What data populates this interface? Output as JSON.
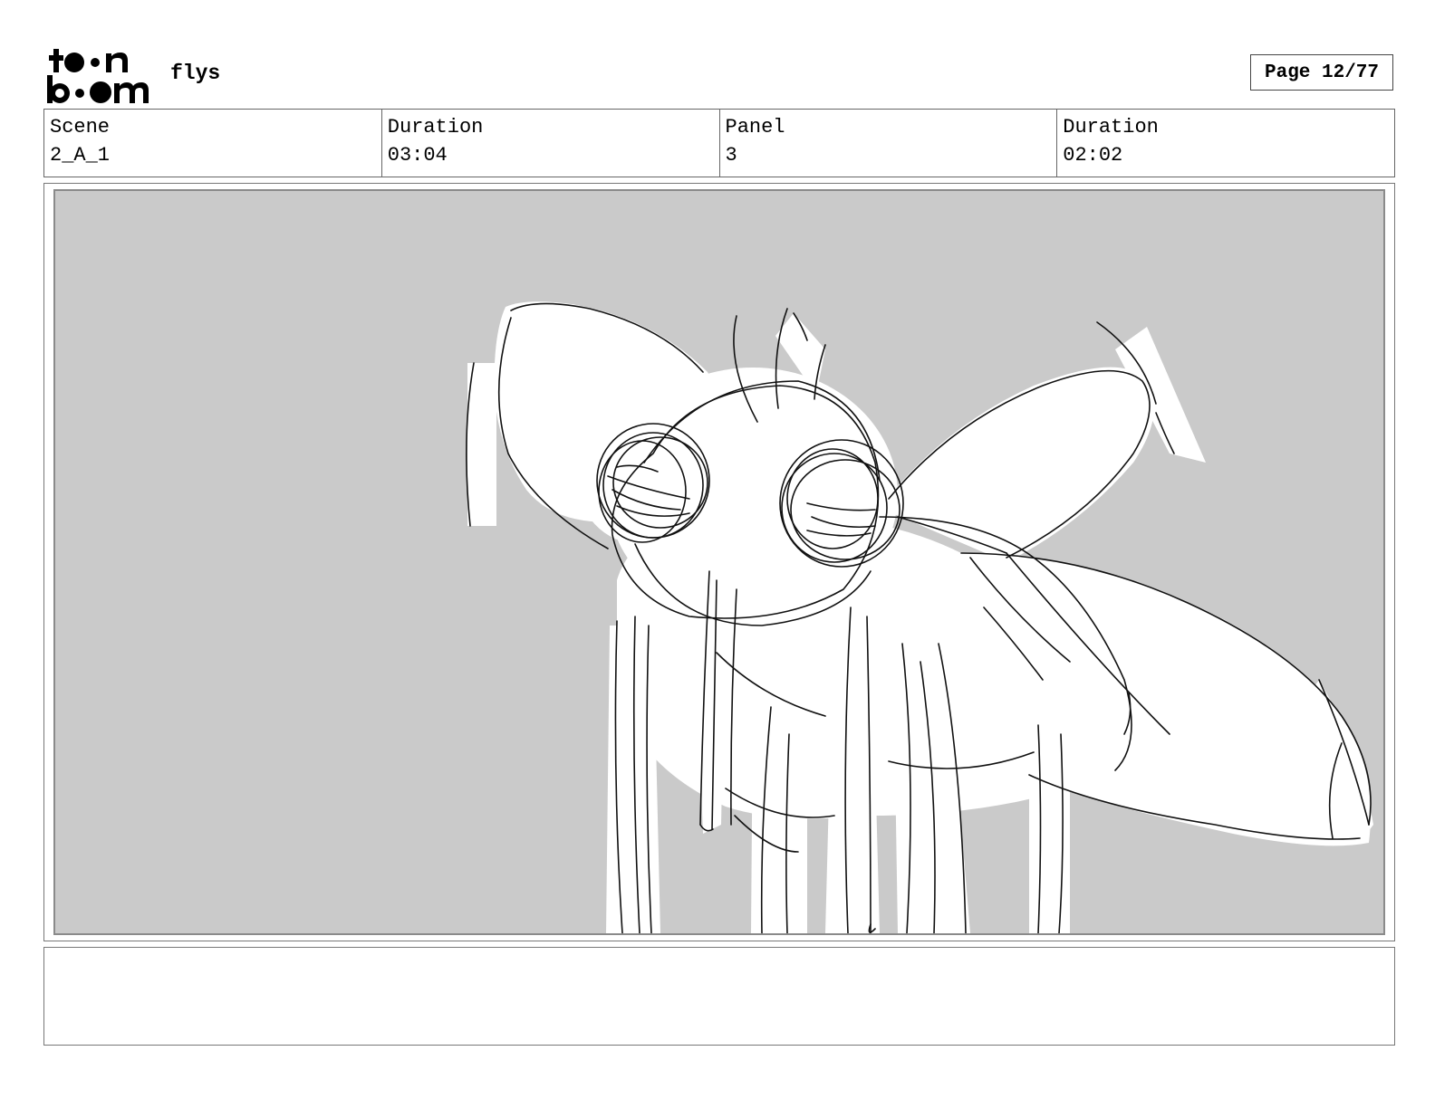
{
  "logo": {
    "icon": "toon-boom-logo",
    "line1": "t●●n",
    "line2": "b●●m"
  },
  "header": {
    "project": "flys",
    "page": "Page 12/77"
  },
  "info": {
    "scene_label": "Scene",
    "scene_value": "2_A_1",
    "scene_duration_label": "Duration",
    "scene_duration_value": "03:04",
    "panel_label": "Panel",
    "panel_value": "3",
    "panel_duration_label": "Duration",
    "panel_duration_value": "02:02"
  },
  "panel": {
    "drawing": "fly-sketch",
    "background": "#cacaca"
  },
  "notes": {
    "text": ""
  }
}
